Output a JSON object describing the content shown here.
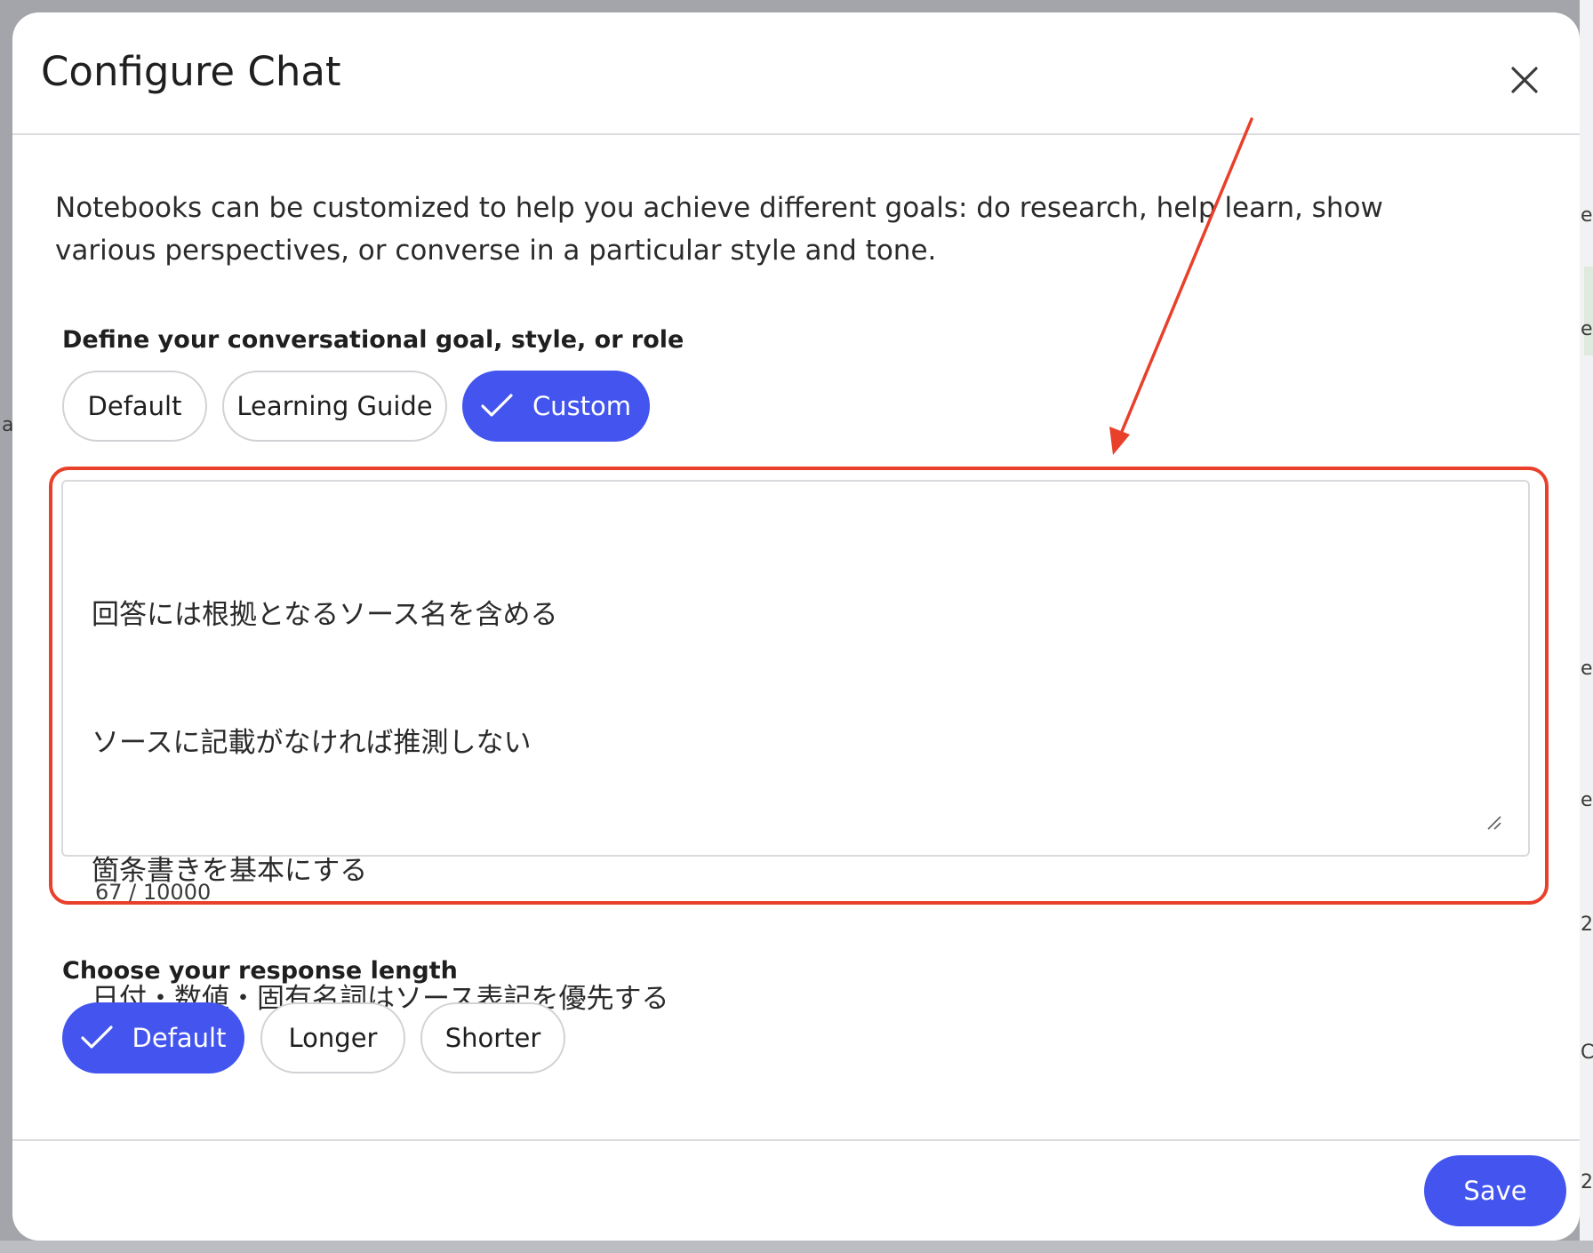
{
  "dialog": {
    "title": "Configure Chat",
    "description": "Notebooks can be customized to help you achieve different goals: do research, help learn, show various perspectives, or converse in a particular style and tone."
  },
  "goal_section": {
    "label": "Define your conversational goal, style, or role",
    "options": [
      {
        "label": "Default",
        "selected": false
      },
      {
        "label": "Learning Guide",
        "selected": false
      },
      {
        "label": "Custom",
        "selected": true
      }
    ]
  },
  "custom_prompt": {
    "lines": [
      "回答には根拠となるソース名を含める",
      "ソースに記載がなければ推測しない",
      "箇条書きを基本にする",
      "日付・数値・固有名詞はソース表記を優先する"
    ],
    "counter": "67 / 10000"
  },
  "length_section": {
    "label": "Choose your response length",
    "options": [
      {
        "label": "Default",
        "selected": true
      },
      {
        "label": "Longer",
        "selected": false
      },
      {
        "label": "Shorter",
        "selected": false
      }
    ]
  },
  "footer": {
    "save_label": "Save"
  },
  "background_fragments": [
    "e",
    "e",
    "e",
    "e",
    "a",
    "2",
    "C",
    "2"
  ],
  "colors": {
    "accent": "#4355ee",
    "annotation": "#e8402a"
  }
}
